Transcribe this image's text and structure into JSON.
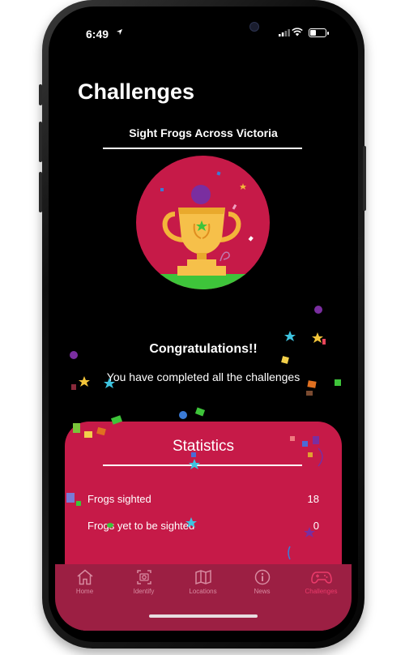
{
  "status_bar": {
    "time": "6:49"
  },
  "page": {
    "title": "Challenges",
    "subtitle": "Sight Frogs Across Victoria"
  },
  "completion": {
    "heading": "Congratulations!!",
    "message": "You have completed all the challenges"
  },
  "statistics": {
    "title": "Statistics",
    "rows": [
      {
        "label": "Frogs sighted",
        "value": "18"
      },
      {
        "label": "Frogs yet to be sighted",
        "value": "0"
      }
    ]
  },
  "tab_bar": {
    "tabs": [
      {
        "label": "Home",
        "icon": "home-icon",
        "active": false
      },
      {
        "label": "Identify",
        "icon": "camera-icon",
        "active": false
      },
      {
        "label": "Locations",
        "icon": "map-icon",
        "active": false
      },
      {
        "label": "News",
        "icon": "info-icon",
        "active": false
      },
      {
        "label": "Challenges",
        "icon": "gamepad-icon",
        "active": true
      }
    ]
  },
  "colors": {
    "accent": "#c61a48",
    "tab_bar": "#9c1f43",
    "active_tab": "#ec3b6b",
    "background": "#000000"
  }
}
